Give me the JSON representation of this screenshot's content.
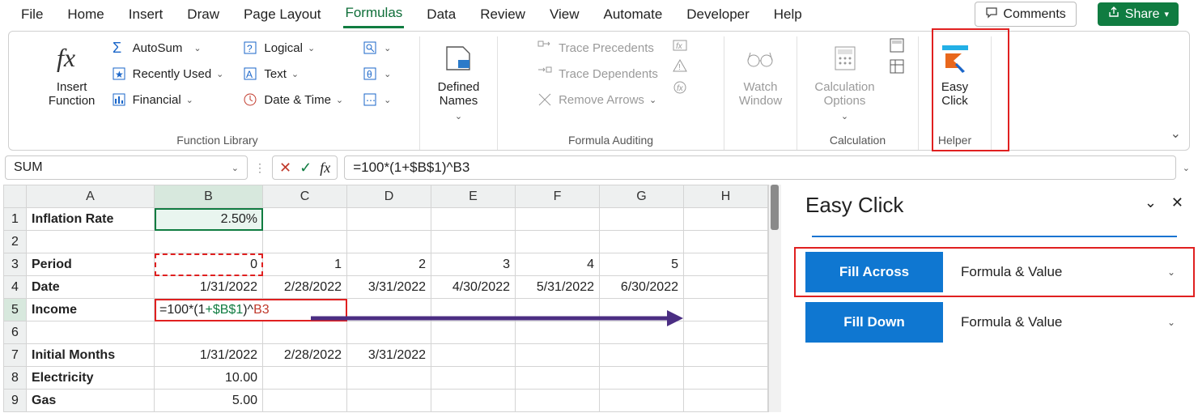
{
  "tabs": {
    "file": "File",
    "home": "Home",
    "insert": "Insert",
    "draw": "Draw",
    "page_layout": "Page Layout",
    "formulas": "Formulas",
    "data": "Data",
    "review": "Review",
    "view": "View",
    "automate": "Automate",
    "developer": "Developer",
    "help": "Help",
    "comments": "Comments",
    "share": "Share"
  },
  "ribbon": {
    "insert_function": "Insert\nFunction",
    "autosum": "AutoSum",
    "recently_used": "Recently Used",
    "financial": "Financial",
    "logical": "Logical",
    "text": "Text",
    "date_time": "Date & Time",
    "defined_names": "Defined\nNames",
    "trace_precedents": "Trace Precedents",
    "trace_dependents": "Trace Dependents",
    "remove_arrows": "Remove Arrows",
    "watch_window": "Watch\nWindow",
    "calc_options": "Calculation\nOptions",
    "easy_click": "Easy\nClick",
    "grp_library": "Function Library",
    "grp_auditing": "Formula Auditing",
    "grp_calc": "Calculation",
    "grp_helper": "Helper"
  },
  "fbar": {
    "namebox": "SUM",
    "formula": "=100*(1+$B$1)^B3",
    "edit_prefix": "=100*(1",
    "edit_ref1": "+$B$1",
    "edit_mid": ")^",
    "edit_ref2": "B3"
  },
  "sheet": {
    "colhdrs": [
      "A",
      "B",
      "C",
      "D",
      "E",
      "F",
      "G",
      "H"
    ],
    "rows": {
      "1": {
        "A": "Inflation Rate",
        "B": "2.50%"
      },
      "3": {
        "A": "Period",
        "B": "0",
        "C": "1",
        "D": "2",
        "E": "3",
        "F": "4",
        "G": "5"
      },
      "4": {
        "A": "Date",
        "B": "1/31/2022",
        "C": "2/28/2022",
        "D": "3/31/2022",
        "E": "4/30/2022",
        "F": "5/31/2022",
        "G": "6/30/2022"
      },
      "5": {
        "A": "Income"
      },
      "7": {
        "A": "Initial Months",
        "B": "1/31/2022",
        "C": "2/28/2022",
        "D": "3/31/2022"
      },
      "8": {
        "A": "Electricity",
        "B": "10.00"
      },
      "9": {
        "A": "Gas",
        "B": "5.00"
      }
    }
  },
  "pane": {
    "title": "Easy Click",
    "fill_across": "Fill Across",
    "fill_down": "Fill Down",
    "mode": "Formula & Value"
  }
}
